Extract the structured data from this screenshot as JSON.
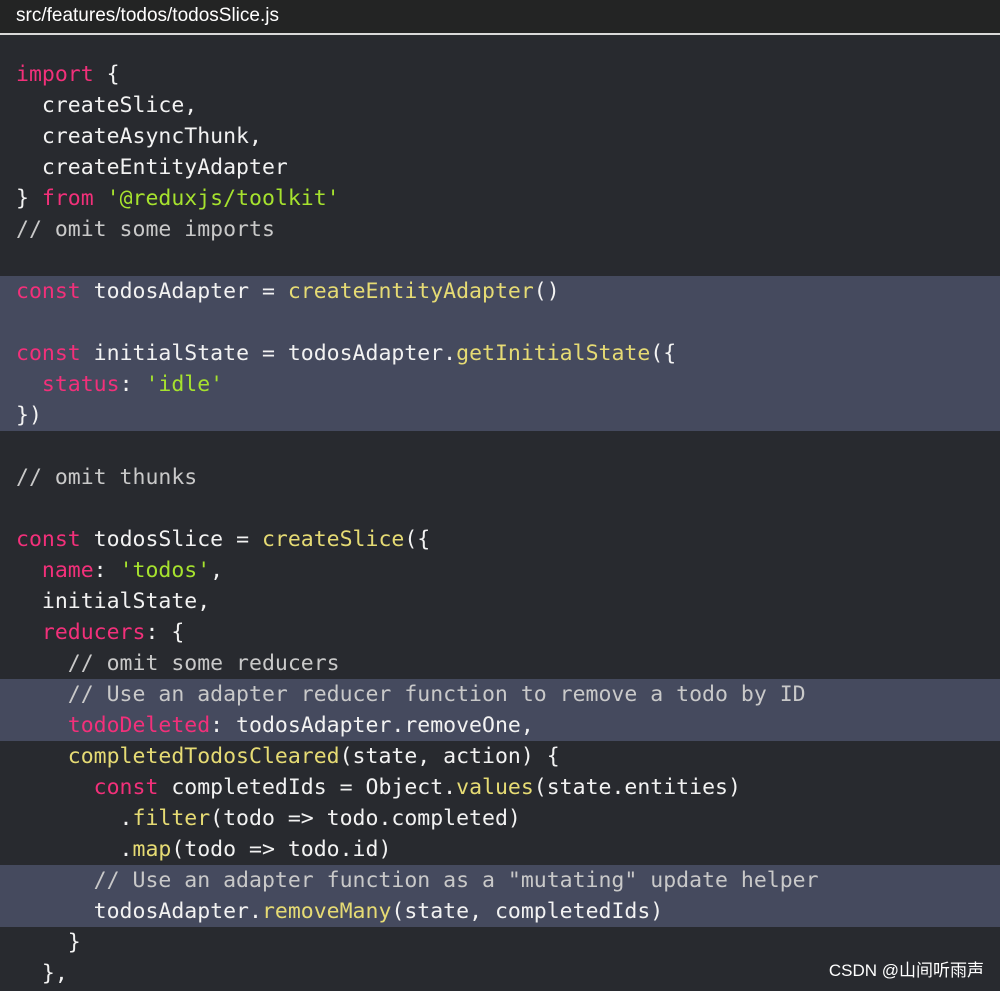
{
  "file": {
    "path": "src/features/todos/todosSlice.js"
  },
  "colors": {
    "background": "#282a2f",
    "highlight": "#454a5e",
    "keyword": "#f2307a",
    "function": "#e6db74",
    "string": "#a6e22e",
    "comment": "#c9c9c9",
    "text": "#f2f2f2"
  },
  "code": {
    "lines": [
      [
        {
          "t": "import",
          "c": "kw"
        },
        {
          "t": " {"
        }
      ],
      [
        {
          "t": "  createSlice,"
        }
      ],
      [
        {
          "t": "  createAsyncThunk,"
        }
      ],
      [
        {
          "t": "  createEntityAdapter"
        }
      ],
      [
        {
          "t": "} "
        },
        {
          "t": "from",
          "c": "kw"
        },
        {
          "t": " "
        },
        {
          "t": "'@reduxjs/toolkit'",
          "c": "str"
        }
      ],
      [
        {
          "t": "// omit some imports",
          "c": "cm"
        }
      ],
      [],
      [
        {
          "t": "const",
          "c": "kw"
        },
        {
          "t": " todosAdapter = "
        },
        {
          "t": "createEntityAdapter",
          "c": "fn"
        },
        {
          "t": "()"
        }
      ],
      [],
      [
        {
          "t": "const",
          "c": "kw"
        },
        {
          "t": " initialState = todosAdapter."
        },
        {
          "t": "getInitialState",
          "c": "fn"
        },
        {
          "t": "({"
        }
      ],
      [
        {
          "t": "  "
        },
        {
          "t": "status",
          "c": "kw"
        },
        {
          "t": ": "
        },
        {
          "t": "'idle'",
          "c": "str"
        }
      ],
      [
        {
          "t": "})"
        }
      ],
      [],
      [
        {
          "t": "// omit thunks",
          "c": "cm"
        }
      ],
      [],
      [
        {
          "t": "const",
          "c": "kw"
        },
        {
          "t": " todosSlice = "
        },
        {
          "t": "createSlice",
          "c": "fn"
        },
        {
          "t": "({"
        }
      ],
      [
        {
          "t": "  "
        },
        {
          "t": "name",
          "c": "kw"
        },
        {
          "t": ": "
        },
        {
          "t": "'todos'",
          "c": "str"
        },
        {
          "t": ","
        }
      ],
      [
        {
          "t": "  initialState,"
        }
      ],
      [
        {
          "t": "  "
        },
        {
          "t": "reducers",
          "c": "kw"
        },
        {
          "t": ": {"
        }
      ],
      [
        {
          "t": "    // omit some reducers",
          "c": "cm"
        }
      ],
      [
        {
          "t": "    // Use an adapter reducer function to remove a todo by ID",
          "c": "cm"
        }
      ],
      [
        {
          "t": "    "
        },
        {
          "t": "todoDeleted",
          "c": "kw"
        },
        {
          "t": ": todosAdapter.removeOne,"
        }
      ],
      [
        {
          "t": "    "
        },
        {
          "t": "completedTodosCleared",
          "c": "fn"
        },
        {
          "t": "(state, action) {"
        }
      ],
      [
        {
          "t": "      "
        },
        {
          "t": "const",
          "c": "kw"
        },
        {
          "t": " completedIds = Object."
        },
        {
          "t": "values",
          "c": "fn"
        },
        {
          "t": "(state.entities)"
        }
      ],
      [
        {
          "t": "        ."
        },
        {
          "t": "filter",
          "c": "fn"
        },
        {
          "t": "(todo => todo.completed)"
        }
      ],
      [
        {
          "t": "        ."
        },
        {
          "t": "map",
          "c": "fn"
        },
        {
          "t": "(todo => todo.id)"
        }
      ],
      [
        {
          "t": "      // Use an adapter function as a \"mutating\" update helper",
          "c": "cm"
        }
      ],
      [
        {
          "t": "      todosAdapter."
        },
        {
          "t": "removeMany",
          "c": "fn"
        },
        {
          "t": "(state, completedIds)"
        }
      ],
      [
        {
          "t": "    }"
        }
      ],
      [
        {
          "t": "  },"
        }
      ]
    ],
    "highlighted_ranges": [
      [
        7,
        11
      ],
      [
        20,
        21
      ],
      [
        26,
        27
      ]
    ]
  },
  "watermark": {
    "text": "CSDN @山间听雨声"
  }
}
